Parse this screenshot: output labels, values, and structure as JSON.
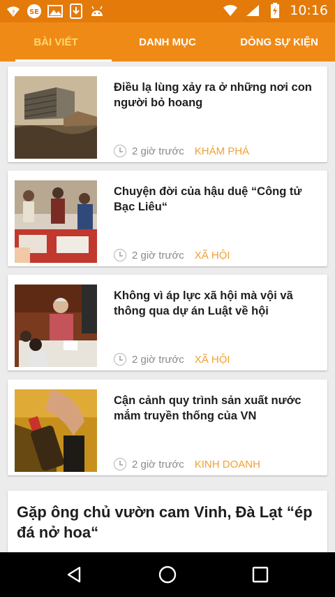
{
  "status_bar": {
    "time": "10:16",
    "left_icons": [
      "wifi-question-icon",
      "sfe-app-icon",
      "photo-icon",
      "download-icon",
      "android-icon"
    ],
    "right_icons": [
      "wifi-icon",
      "signal-icon",
      "battery-charging-icon"
    ]
  },
  "tabs": [
    {
      "label": "BÀI VIẾT",
      "active": true
    },
    {
      "label": "DANH MỤC",
      "active": false
    },
    {
      "label": "DÒNG SỰ KIỆN",
      "active": false
    }
  ],
  "articles": [
    {
      "title": "Điều lạ lùng xảy ra ở những nơi con người bỏ hoang",
      "time": "2 giờ trước",
      "category": "KHÁM PHÁ",
      "thumb": "abandoned-building-photo"
    },
    {
      "title": "Chuyện đời của hậu duệ “Công tử Bạc Liêu“",
      "time": "2 giờ trước",
      "category": "XÃ HỘI",
      "thumb": "people-at-table-photo"
    },
    {
      "title": "Không vì áp lực xã hội mà vội vã thông qua dự án Luật về hội",
      "time": "2 giờ trước",
      "category": "XÃ HỘI",
      "thumb": "assembly-speaker-photo"
    },
    {
      "title": "Cận cảnh quy trình sản xuất nước mắm truyền thống của VN",
      "time": "2 giờ trước",
      "category": "KINH DOANH",
      "thumb": "fish-sauce-bottle-photo"
    }
  ],
  "featured": {
    "title": "Gặp ông chủ vườn cam Vinh, Đà Lạt “ép đá nở hoa“"
  },
  "colors": {
    "status_bar": "#e37a0a",
    "tab_bar": "#f08a16",
    "active_tab": "#ffd96b",
    "category": "#f0a030"
  },
  "nav_bar": {
    "buttons": [
      "back-icon",
      "home-icon",
      "recents-icon"
    ]
  }
}
